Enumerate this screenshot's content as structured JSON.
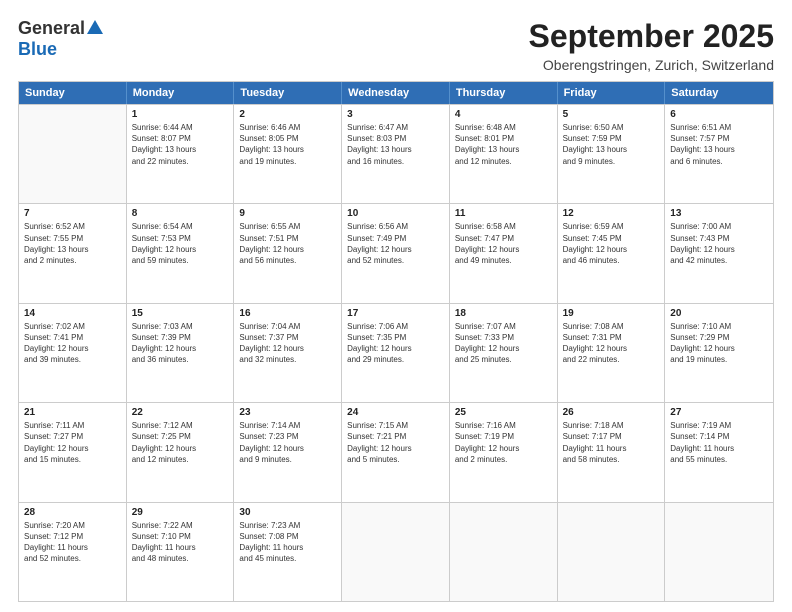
{
  "logo": {
    "general": "General",
    "blue": "Blue"
  },
  "title": "September 2025",
  "location": "Oberengstringen, Zurich, Switzerland",
  "days": [
    "Sunday",
    "Monday",
    "Tuesday",
    "Wednesday",
    "Thursday",
    "Friday",
    "Saturday"
  ],
  "rows": [
    [
      {
        "day": "",
        "info": ""
      },
      {
        "day": "1",
        "info": "Sunrise: 6:44 AM\nSunset: 8:07 PM\nDaylight: 13 hours\nand 22 minutes."
      },
      {
        "day": "2",
        "info": "Sunrise: 6:46 AM\nSunset: 8:05 PM\nDaylight: 13 hours\nand 19 minutes."
      },
      {
        "day": "3",
        "info": "Sunrise: 6:47 AM\nSunset: 8:03 PM\nDaylight: 13 hours\nand 16 minutes."
      },
      {
        "day": "4",
        "info": "Sunrise: 6:48 AM\nSunset: 8:01 PM\nDaylight: 13 hours\nand 12 minutes."
      },
      {
        "day": "5",
        "info": "Sunrise: 6:50 AM\nSunset: 7:59 PM\nDaylight: 13 hours\nand 9 minutes."
      },
      {
        "day": "6",
        "info": "Sunrise: 6:51 AM\nSunset: 7:57 PM\nDaylight: 13 hours\nand 6 minutes."
      }
    ],
    [
      {
        "day": "7",
        "info": "Sunrise: 6:52 AM\nSunset: 7:55 PM\nDaylight: 13 hours\nand 2 minutes."
      },
      {
        "day": "8",
        "info": "Sunrise: 6:54 AM\nSunset: 7:53 PM\nDaylight: 12 hours\nand 59 minutes."
      },
      {
        "day": "9",
        "info": "Sunrise: 6:55 AM\nSunset: 7:51 PM\nDaylight: 12 hours\nand 56 minutes."
      },
      {
        "day": "10",
        "info": "Sunrise: 6:56 AM\nSunset: 7:49 PM\nDaylight: 12 hours\nand 52 minutes."
      },
      {
        "day": "11",
        "info": "Sunrise: 6:58 AM\nSunset: 7:47 PM\nDaylight: 12 hours\nand 49 minutes."
      },
      {
        "day": "12",
        "info": "Sunrise: 6:59 AM\nSunset: 7:45 PM\nDaylight: 12 hours\nand 46 minutes."
      },
      {
        "day": "13",
        "info": "Sunrise: 7:00 AM\nSunset: 7:43 PM\nDaylight: 12 hours\nand 42 minutes."
      }
    ],
    [
      {
        "day": "14",
        "info": "Sunrise: 7:02 AM\nSunset: 7:41 PM\nDaylight: 12 hours\nand 39 minutes."
      },
      {
        "day": "15",
        "info": "Sunrise: 7:03 AM\nSunset: 7:39 PM\nDaylight: 12 hours\nand 36 minutes."
      },
      {
        "day": "16",
        "info": "Sunrise: 7:04 AM\nSunset: 7:37 PM\nDaylight: 12 hours\nand 32 minutes."
      },
      {
        "day": "17",
        "info": "Sunrise: 7:06 AM\nSunset: 7:35 PM\nDaylight: 12 hours\nand 29 minutes."
      },
      {
        "day": "18",
        "info": "Sunrise: 7:07 AM\nSunset: 7:33 PM\nDaylight: 12 hours\nand 25 minutes."
      },
      {
        "day": "19",
        "info": "Sunrise: 7:08 AM\nSunset: 7:31 PM\nDaylight: 12 hours\nand 22 minutes."
      },
      {
        "day": "20",
        "info": "Sunrise: 7:10 AM\nSunset: 7:29 PM\nDaylight: 12 hours\nand 19 minutes."
      }
    ],
    [
      {
        "day": "21",
        "info": "Sunrise: 7:11 AM\nSunset: 7:27 PM\nDaylight: 12 hours\nand 15 minutes."
      },
      {
        "day": "22",
        "info": "Sunrise: 7:12 AM\nSunset: 7:25 PM\nDaylight: 12 hours\nand 12 minutes."
      },
      {
        "day": "23",
        "info": "Sunrise: 7:14 AM\nSunset: 7:23 PM\nDaylight: 12 hours\nand 9 minutes."
      },
      {
        "day": "24",
        "info": "Sunrise: 7:15 AM\nSunset: 7:21 PM\nDaylight: 12 hours\nand 5 minutes."
      },
      {
        "day": "25",
        "info": "Sunrise: 7:16 AM\nSunset: 7:19 PM\nDaylight: 12 hours\nand 2 minutes."
      },
      {
        "day": "26",
        "info": "Sunrise: 7:18 AM\nSunset: 7:17 PM\nDaylight: 11 hours\nand 58 minutes."
      },
      {
        "day": "27",
        "info": "Sunrise: 7:19 AM\nSunset: 7:14 PM\nDaylight: 11 hours\nand 55 minutes."
      }
    ],
    [
      {
        "day": "28",
        "info": "Sunrise: 7:20 AM\nSunset: 7:12 PM\nDaylight: 11 hours\nand 52 minutes."
      },
      {
        "day": "29",
        "info": "Sunrise: 7:22 AM\nSunset: 7:10 PM\nDaylight: 11 hours\nand 48 minutes."
      },
      {
        "day": "30",
        "info": "Sunrise: 7:23 AM\nSunset: 7:08 PM\nDaylight: 11 hours\nand 45 minutes."
      },
      {
        "day": "",
        "info": ""
      },
      {
        "day": "",
        "info": ""
      },
      {
        "day": "",
        "info": ""
      },
      {
        "day": "",
        "info": ""
      }
    ]
  ]
}
